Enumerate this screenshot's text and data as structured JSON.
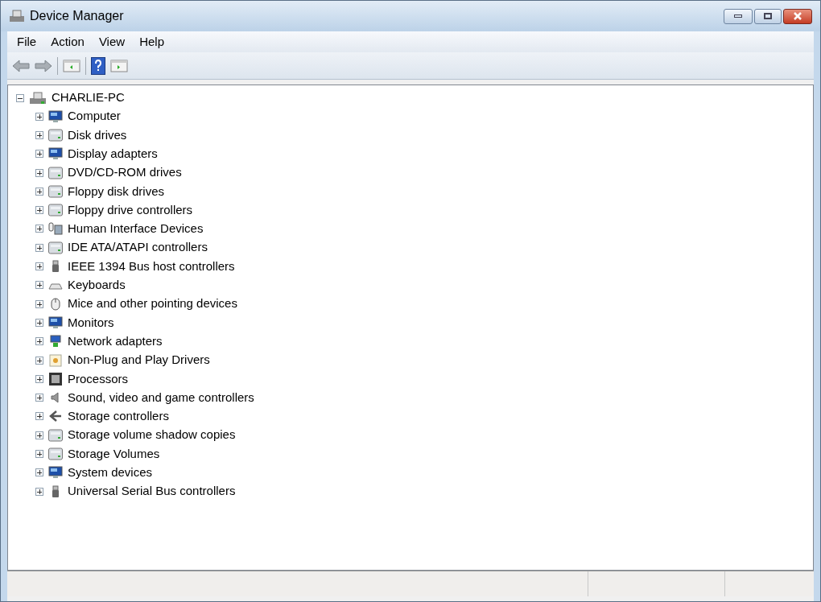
{
  "window": {
    "title": "Device Manager"
  },
  "menu": [
    "File",
    "Action",
    "View",
    "Help"
  ],
  "tree": {
    "label": "CHARLIE-PC",
    "expanded": true,
    "children": [
      {
        "label": "Computer",
        "expanded": false
      },
      {
        "label": "Disk drives",
        "expanded": false
      },
      {
        "label": "Display adapters",
        "expanded": false
      },
      {
        "label": "DVD/CD-ROM drives",
        "expanded": false
      },
      {
        "label": "Floppy disk drives",
        "expanded": false
      },
      {
        "label": "Floppy drive controllers",
        "expanded": false
      },
      {
        "label": "Human Interface Devices",
        "expanded": false
      },
      {
        "label": "IDE ATA/ATAPI controllers",
        "expanded": false
      },
      {
        "label": "IEEE 1394 Bus host controllers",
        "expanded": false
      },
      {
        "label": "Keyboards",
        "expanded": false
      },
      {
        "label": "Mice and other pointing devices",
        "expanded": false
      },
      {
        "label": "Monitors",
        "expanded": false
      },
      {
        "label": "Network adapters",
        "expanded": false
      },
      {
        "label": "Non-Plug and Play Drivers",
        "expanded": false
      },
      {
        "label": "Processors",
        "expanded": false
      },
      {
        "label": "Sound, video and game controllers",
        "expanded": false
      },
      {
        "label": "Storage controllers",
        "expanded": false
      },
      {
        "label": "Storage volume shadow copies",
        "expanded": false
      },
      {
        "label": "Storage Volumes",
        "expanded": false
      },
      {
        "label": "System devices",
        "expanded": false
      },
      {
        "label": "Universal Serial Bus controllers",
        "expanded": false
      }
    ]
  }
}
